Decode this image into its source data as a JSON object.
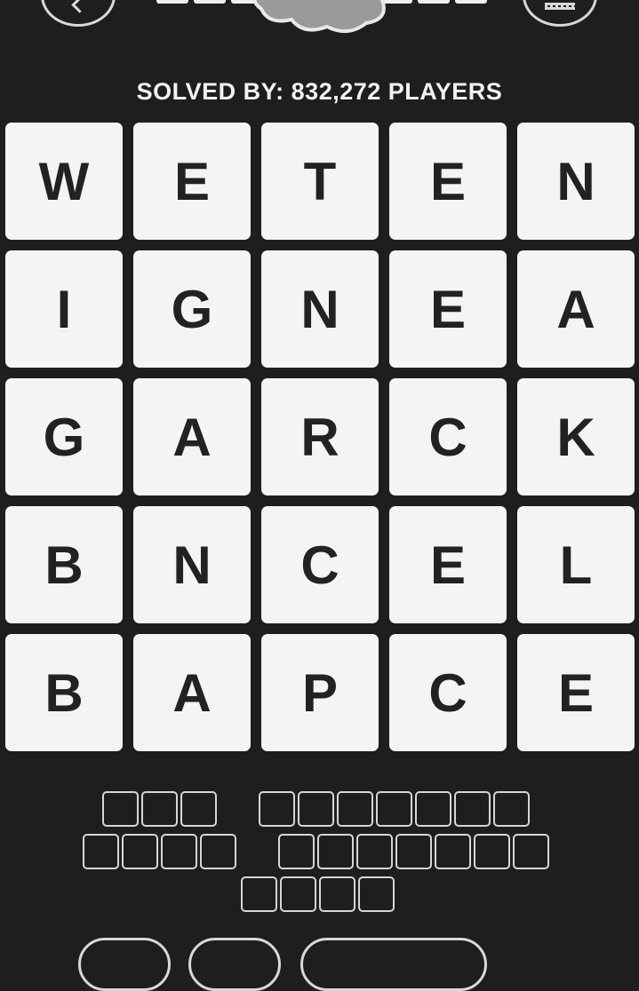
{
  "header": {
    "back_icon": "chevron-left-icon",
    "menu_icon": "keyboard-icon",
    "top_slot_count": 9
  },
  "status": {
    "solved_text": "SOLVED BY: 832,272 PLAYERS"
  },
  "grid": {
    "rows": [
      [
        "W",
        "E",
        "T",
        "E",
        "N"
      ],
      [
        "I",
        "G",
        "N",
        "E",
        "A"
      ],
      [
        "G",
        "A",
        "R",
        "C",
        "K"
      ],
      [
        "B",
        "N",
        "C",
        "E",
        "L"
      ],
      [
        "B",
        "A",
        "P",
        "C",
        "E"
      ]
    ]
  },
  "answers": {
    "rows": [
      [
        3,
        7
      ],
      [
        4,
        7
      ],
      [
        4
      ]
    ]
  },
  "colors": {
    "background": "#1e1e1e",
    "tile": "#f4f4f4",
    "tile_text": "#222222",
    "outline": "#d6d6d6"
  }
}
